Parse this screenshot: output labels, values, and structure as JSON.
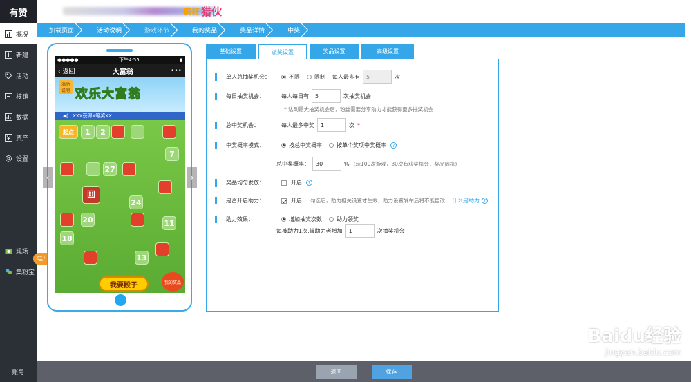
{
  "brand": {
    "logo": "有赞"
  },
  "sidebar": {
    "items": [
      {
        "label": "概况",
        "icon": "chart-icon"
      },
      {
        "label": "新建",
        "icon": "plus-icon"
      },
      {
        "label": "活动",
        "icon": "tag-icon"
      },
      {
        "label": "核销",
        "icon": "ticket-icon"
      },
      {
        "label": "数据",
        "icon": "data-icon"
      },
      {
        "label": "资产",
        "icon": "yen-icon"
      },
      {
        "label": "设置",
        "icon": "gear-icon"
      }
    ],
    "lower_items": [
      {
        "label": "现场",
        "icon": "scene-icon"
      },
      {
        "label": "集粉宝",
        "icon": "fans-icon"
      }
    ],
    "account": "账号",
    "promo": "哇！免10块随意用"
  },
  "banner": {
    "part1": "疯狂",
    "part2": "猎伙"
  },
  "steps": [
    "加载页面",
    "活动说明",
    "游戏环节",
    "我的奖品",
    "奖品详情",
    "中奖"
  ],
  "phone": {
    "status_left": "●●●●●",
    "time": "下午4:55",
    "status_right": "▮",
    "back": "返回",
    "title": "大富翁",
    "menu": "•••",
    "game_tag": "活动说明",
    "game_title": "欢乐大富翁",
    "marquee": "XXX获得X等奖XX",
    "start": "起点",
    "tiles": [
      "1",
      "2",
      "7",
      "27",
      "24",
      "20",
      "11",
      "18",
      "13"
    ],
    "dice_button": "我要骰子",
    "my_prize": "我的奖品"
  },
  "tabs": [
    "基础设置",
    "派奖设置",
    "奖品设置",
    "高级设置"
  ],
  "form": {
    "single_chance": {
      "label": "单人总抽奖机会：",
      "opt_unlimited": "不限",
      "opt_limit": "限制",
      "per_person_prefix": "每人最多有",
      "value": "5",
      "unit": "次"
    },
    "daily_chance": {
      "label": "每日抽奖机会：",
      "prefix": "每人每日有",
      "value": "5",
      "suffix": "次抽奖机会",
      "hint": "* 达到最大抽奖机会后，粉丝需要分享助力才能获得更多抽奖机会"
    },
    "total_win": {
      "label": "总中奖机会：",
      "prefix": "每人最多中奖",
      "value": "1",
      "suffix": "次",
      "required": "*"
    },
    "win_mode": {
      "label": "中奖概率模式：",
      "opt_total": "按总中奖概率",
      "opt_single": "按单个奖项中奖概率",
      "rate_label": "总中奖概率：",
      "rate_value": "30",
      "rate_unit": "%",
      "rate_hint": "(玩100次游戏，30次有获奖机会，奖品随机)"
    },
    "even_award": {
      "label": "奖品均匀发放：",
      "text": "开启"
    },
    "assist": {
      "label": "是否开启助力：",
      "text": "开启",
      "hint": "勾选后，助力相关设置才生效，助力设置发布后将不能更改",
      "link": "什么是助力"
    },
    "assist_effect": {
      "label": "助力效果：",
      "opt_add": "增加抽奖次数",
      "opt_claim": "助力领奖",
      "per_prefix": "每被助力1次,被助力者增加",
      "value": "1",
      "suffix": "次抽奖机会"
    }
  },
  "footer": {
    "back": "返回",
    "save": "保存"
  },
  "watermark": {
    "main": "Baidu经验",
    "sub": "jingyan.baidu.com"
  },
  "colors": {
    "accent": "#35a7e8",
    "sidebar": "#2b2f36",
    "footer": "#5d6068",
    "promo": "#f39a2b"
  }
}
